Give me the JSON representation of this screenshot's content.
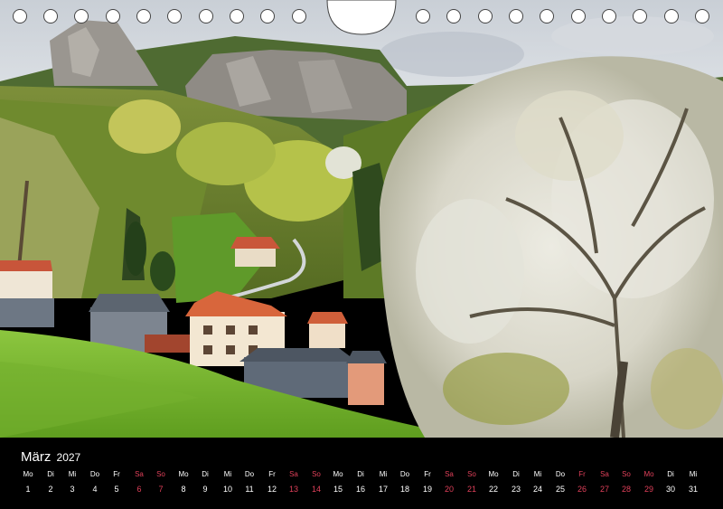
{
  "calendar": {
    "month": "März",
    "year": "2027"
  },
  "days": [
    {
      "weekday": "Mo",
      "day": "1",
      "red": false
    },
    {
      "weekday": "Di",
      "day": "2",
      "red": false
    },
    {
      "weekday": "Mi",
      "day": "3",
      "red": false
    },
    {
      "weekday": "Do",
      "day": "4",
      "red": false
    },
    {
      "weekday": "Fr",
      "day": "5",
      "red": false
    },
    {
      "weekday": "Sa",
      "day": "6",
      "red": true
    },
    {
      "weekday": "So",
      "day": "7",
      "red": true
    },
    {
      "weekday": "Mo",
      "day": "8",
      "red": false
    },
    {
      "weekday": "Di",
      "day": "9",
      "red": false
    },
    {
      "weekday": "Mi",
      "day": "10",
      "red": false
    },
    {
      "weekday": "Do",
      "day": "11",
      "red": false
    },
    {
      "weekday": "Fr",
      "day": "12",
      "red": false
    },
    {
      "weekday": "Sa",
      "day": "13",
      "red": true
    },
    {
      "weekday": "So",
      "day": "14",
      "red": true
    },
    {
      "weekday": "Mo",
      "day": "15",
      "red": false
    },
    {
      "weekday": "Di",
      "day": "16",
      "red": false
    },
    {
      "weekday": "Mi",
      "day": "17",
      "red": false
    },
    {
      "weekday": "Do",
      "day": "18",
      "red": false
    },
    {
      "weekday": "Fr",
      "day": "19",
      "red": false
    },
    {
      "weekday": "Sa",
      "day": "20",
      "red": true
    },
    {
      "weekday": "So",
      "day": "21",
      "red": true
    },
    {
      "weekday": "Mo",
      "day": "22",
      "red": false
    },
    {
      "weekday": "Di",
      "day": "23",
      "red": false
    },
    {
      "weekday": "Mi",
      "day": "24",
      "red": false
    },
    {
      "weekday": "Do",
      "day": "25",
      "red": false
    },
    {
      "weekday": "Fr",
      "day": "26",
      "red": true
    },
    {
      "weekday": "Sa",
      "day": "27",
      "red": true
    },
    {
      "weekday": "So",
      "day": "28",
      "red": true
    },
    {
      "weekday": "Mo",
      "day": "29",
      "red": true
    },
    {
      "weekday": "Di",
      "day": "30",
      "red": false
    },
    {
      "weekday": "Mi",
      "day": "31",
      "red": false
    }
  ],
  "colors": {
    "weekend": "#e0405a",
    "text": "#ffffff",
    "strip_background": "#000000"
  },
  "icons": {
    "binding_hole": "binding-hole-icon",
    "hanger": "hanger-notch-icon"
  }
}
